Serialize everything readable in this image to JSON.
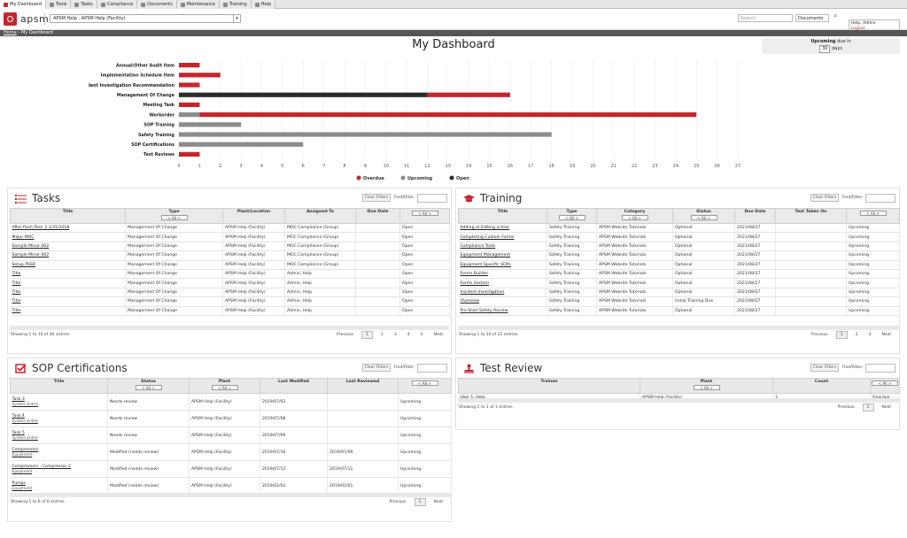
{
  "tabs": [
    {
      "label": "My Dashboard",
      "active": true
    },
    {
      "label": "Tools"
    },
    {
      "label": "Tasks"
    },
    {
      "label": "Compliance"
    },
    {
      "label": "Documents"
    },
    {
      "label": "Maintenance"
    },
    {
      "label": "Training"
    },
    {
      "label": "Help"
    }
  ],
  "header": {
    "logo_text": "apsm",
    "facility": "APSM Help : APSM Help (Facility)",
    "search_placeholder": "Search",
    "search_scope": "Documents",
    "user_name": "Help, Admin",
    "user_link": "Logout"
  },
  "breadcrumb": {
    "home": "Home",
    "separator": " › ",
    "current": "My Dashboard"
  },
  "page_title": "My Dashboard",
  "upcoming": {
    "label": "Upcoming",
    "suffix": "due in",
    "value": "30",
    "unit": "days"
  },
  "chart_data": {
    "type": "bar",
    "orientation": "horizontal",
    "stacked": true,
    "categories": [
      "Annual/Other Audit Item",
      "Implementation Schedule Item",
      "Incident Investigation Recommendation",
      "Management Of Change",
      "Meeting Task",
      "Workorder",
      "SOP Training",
      "Safety Training",
      "SOP Certifications",
      "Test Reviews"
    ],
    "series": [
      {
        "name": "Overdue",
        "color": "#c4262e",
        "values": [
          1,
          2,
          1,
          4,
          1,
          24,
          0,
          0,
          0,
          1
        ]
      },
      {
        "name": "Upcoming",
        "color": "#8c8c8c",
        "values": [
          0,
          0,
          0,
          0,
          0,
          1,
          3,
          18,
          6,
          0
        ]
      },
      {
        "name": "Open",
        "color": "#2b2b2b",
        "values": [
          0,
          0,
          0,
          12,
          0,
          0,
          0,
          0,
          0,
          0
        ]
      }
    ],
    "xlim": [
      0,
      27
    ],
    "x_ticks": [
      0,
      1,
      2,
      3,
      4,
      5,
      6,
      7,
      8,
      9,
      10,
      11,
      12,
      13,
      14,
      15,
      16,
      17,
      18,
      19,
      20,
      21,
      22,
      23,
      24,
      25,
      26,
      27
    ],
    "grid": true,
    "legend_position": "bottom"
  },
  "tasks": {
    "title": "Tasks",
    "clear": "Clear Filters",
    "find": "Find/Filter:",
    "columns": [
      "Title",
      "Type",
      "Plant/Location",
      "Assigned To",
      "Due Date",
      "Status"
    ],
    "filter_label": "< All >",
    "rows": [
      [
        "After Push Test: 2 1/31/2018",
        "Management Of Change",
        "APSM Help (Facility)",
        "MOC Compliance (Group)",
        "",
        "Open"
      ],
      [
        "Major MOC",
        "Management Of Change",
        "APSM Help (Facility)",
        "MOC Compliance (Group)",
        "",
        "Open"
      ],
      [
        "Sample Minor 002",
        "Management Of Change",
        "APSM Help (Facility)",
        "MOC Compliance (Group)",
        "",
        "Open"
      ],
      [
        "Sample Minor 002",
        "Management Of Change",
        "APSM Help (Facility)",
        "MOC Compliance (Group)",
        "",
        "Open"
      ],
      [
        "Setup PSSR",
        "Management Of Change",
        "APSM Help (Facility)",
        "MOC Compliance (Group)",
        "",
        "Open"
      ],
      [
        "Title",
        "Management Of Change",
        "APSM Help (Facility)",
        "Admin, Help",
        "",
        "Open"
      ],
      [
        "Title",
        "Management Of Change",
        "APSM Help (Facility)",
        "Admin, Help",
        "",
        "Open"
      ],
      [
        "Title",
        "Management Of Change",
        "APSM Help (Facility)",
        "Admin, Help",
        "",
        "Open"
      ],
      [
        "Title",
        "Management Of Change",
        "APSM Help (Facility)",
        "Admin, Help",
        "",
        "Open"
      ],
      [
        "Title",
        "Management Of Change",
        "APSM Help (Facility)",
        "Admin, Help",
        "",
        "Open"
      ]
    ],
    "showing": "Showing 1 to 10 of 46 entries",
    "pager": {
      "prev": "Previous",
      "pages": [
        "1",
        "2",
        "3",
        "4",
        "5"
      ],
      "next": "Next"
    }
  },
  "training": {
    "title": "Training",
    "clear": "Clear Filters",
    "find": "Find/Filter:",
    "columns": [
      "Title",
      "Type",
      "Category",
      "Status",
      "Due Date",
      "Test Taken On",
      "Status"
    ],
    "filter_label": "< All >",
    "rows": [
      [
        "Adding or Editing a User",
        "Safety Training",
        "APSM Website Tutorials",
        "Optional",
        "2021/08/27",
        "",
        "Upcoming"
      ],
      [
        "Completing Custom Forms",
        "Safety Training",
        "APSM Website Tutorials",
        "Optional",
        "2021/08/27",
        "",
        "Upcoming"
      ],
      [
        "Compliance Tools",
        "Safety Training",
        "APSM Website Tutorials",
        "Optional",
        "2021/08/27",
        "",
        "Upcoming"
      ],
      [
        "Equipment Management",
        "Safety Training",
        "APSM Website Tutorials",
        "Optional",
        "2021/08/27",
        "",
        "Upcoming"
      ],
      [
        "Equipment Specific SOPs",
        "Safety Training",
        "APSM Website Tutorials",
        "Optional",
        "2021/08/27",
        "",
        "Upcoming"
      ],
      [
        "Forms Builder",
        "Safety Training",
        "APSM Website Tutorials",
        "Optional",
        "2021/08/27",
        "",
        "Upcoming"
      ],
      [
        "Forms Section",
        "Safety Training",
        "APSM Website Tutorials",
        "Optional",
        "2021/08/27",
        "",
        "Upcoming"
      ],
      [
        "Incident Investigation",
        "Safety Training",
        "APSM Website Tutorials",
        "Optional",
        "2021/08/27",
        "",
        "Upcoming"
      ],
      [
        "Overview",
        "Safety Training",
        "APSM Website Tutorials",
        "Initial Training Due",
        "2021/08/27",
        "",
        "Upcoming"
      ],
      [
        "Pre Start Safety Review",
        "Safety Training",
        "APSM Website Tutorials",
        "Optional",
        "2021/08/27",
        "",
        "Upcoming"
      ]
    ],
    "showing": "Showing 1 to 10 of 21 entries",
    "pager": {
      "prev": "Previous",
      "pages": [
        "1",
        "2",
        "3"
      ],
      "next": "Next"
    }
  },
  "sop": {
    "title": "SOP Certifications",
    "clear": "Clear Filters",
    "find": "Find/Filter:",
    "columns": [
      "Title",
      "Status",
      "Plant",
      "Last Modified",
      "Last Reviewed",
      "Status"
    ],
    "filter_label": "< All >",
    "rows": [
      [
        "Task 3",
        "System Entire",
        "Needs review",
        "APSM Help (Facility)",
        "2019/07/02",
        "",
        "Upcoming"
      ],
      [
        "Task 4",
        "System Entire",
        "Needs review",
        "APSM Help (Facility)",
        "2019/07/08",
        "",
        "Upcoming"
      ],
      [
        "Task 5",
        "System Entire",
        "Needs review",
        "APSM Help (Facility)",
        "2019/07/09",
        "",
        "Upcoming"
      ],
      [
        "Compressors",
        "Equipment",
        "Modified (needs review)",
        "APSM Help (Facility)",
        "2019/07/16",
        "2019/07/09",
        "Upcoming"
      ],
      [
        "Compressors - Compressor 2",
        "Equipment",
        "Modified (needs review)",
        "APSM Help (Facility)",
        "2019/07/12",
        "2019/07/11",
        "Upcoming"
      ],
      [
        "Pumps",
        "Equipment",
        "Modified (needs review)",
        "APSM Help (Facility)",
        "2019/02/02",
        "2019/02/01",
        "Upcoming"
      ]
    ],
    "showing": "Showing 1 to 6 of 6 entries",
    "pager": {
      "prev": "Previous",
      "pages": [
        "1"
      ],
      "next": "Next"
    }
  },
  "test_review": {
    "title": "Test Review",
    "clear": "Clear Filters",
    "find": "Find/Filter:",
    "columns": [
      "Trainee",
      "Plant",
      "Count",
      "Status"
    ],
    "filter_label": "< All >",
    "rows": [
      [
        "User 1, Help",
        "APSM Help (Facility)",
        "1",
        "Overdue"
      ]
    ],
    "showing": "Showing 1 to 1 of 1 entries",
    "pager": {
      "prev": "Previous",
      "pages": [
        "1"
      ],
      "next": "Next"
    }
  }
}
